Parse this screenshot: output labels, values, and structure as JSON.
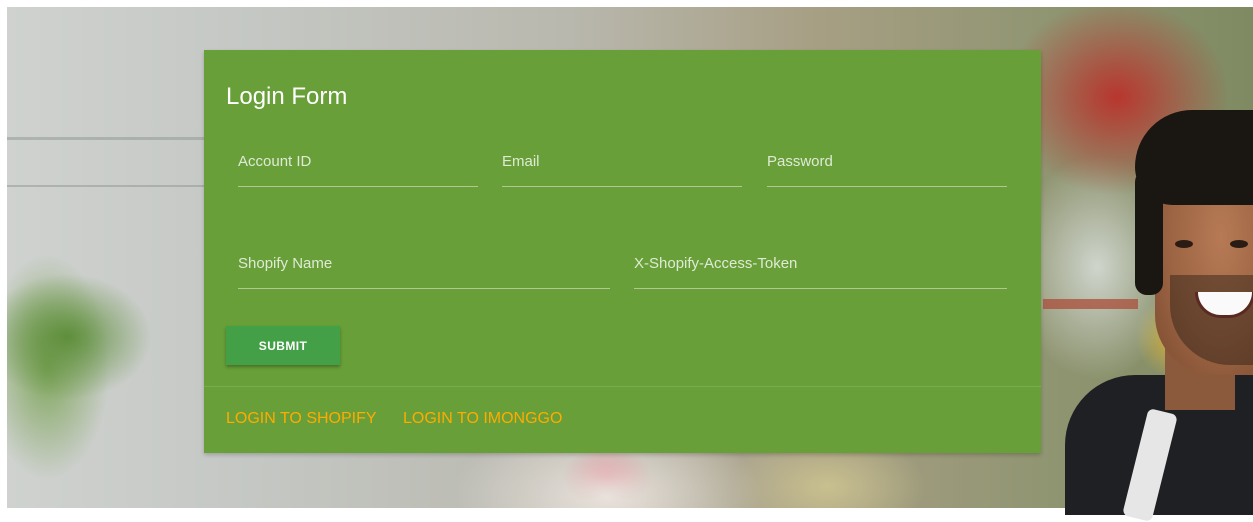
{
  "form": {
    "title": "Login Form",
    "fields": {
      "account_id": {
        "placeholder": "Account ID",
        "value": ""
      },
      "email": {
        "placeholder": "Email",
        "value": ""
      },
      "password": {
        "placeholder": "Password",
        "value": ""
      },
      "shopify_name": {
        "placeholder": "Shopify Name",
        "value": ""
      },
      "access_token": {
        "placeholder": "X-Shopify-Access-Token",
        "value": ""
      }
    },
    "submit_label": "SUBMIT"
  },
  "actions": {
    "login_shopify": "LOGIN TO SHOPIFY",
    "login_imonggo": "LOGIN TO IMONGGO"
  },
  "colors": {
    "card": "#689f38",
    "submit": "#43a047",
    "link": "#ffab00",
    "title": "#ffffff"
  }
}
